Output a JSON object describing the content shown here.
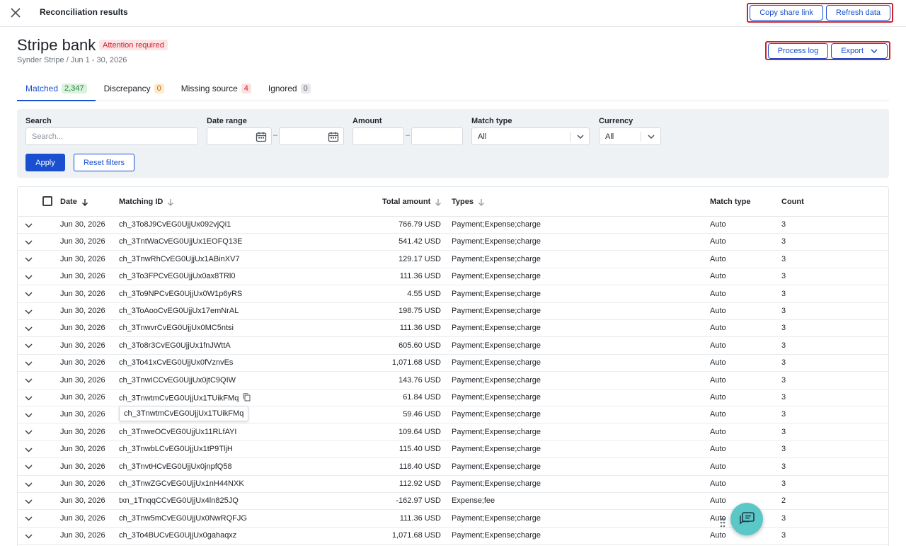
{
  "topbar": {
    "title": "Reconciliation results",
    "copy_share_link": "Copy share link",
    "refresh_data": "Refresh data"
  },
  "header": {
    "title": "Stripe bank",
    "status_badge": "Attention required",
    "subtitle": "Synder Stripe / Jun 1 - 30, 2026",
    "process_log": "Process log",
    "export": "Export"
  },
  "tabs": [
    {
      "label": "Matched",
      "count": "2,347"
    },
    {
      "label": "Discrepancy",
      "count": "0"
    },
    {
      "label": "Missing source",
      "count": "4"
    },
    {
      "label": "Ignored",
      "count": "0"
    }
  ],
  "filters": {
    "search_label": "Search",
    "search_placeholder": "Search...",
    "date_range_label": "Date range",
    "amount_label": "Amount",
    "match_type_label": "Match type",
    "match_type_value": "All",
    "currency_label": "Currency",
    "currency_value": "All",
    "apply": "Apply",
    "reset": "Reset filters",
    "range_separator": "–"
  },
  "table": {
    "columns": {
      "date": "Date",
      "matching_id": "Matching ID",
      "total_amount": "Total amount",
      "types": "Types",
      "match_type": "Match type",
      "count": "Count"
    },
    "rows": [
      {
        "date": "Jun 30, 2026",
        "id": "ch_3To8J9CvEG0UjjUx092vjQi1",
        "amount": "766.79 USD",
        "types": "Payment;Expense;charge",
        "match": "Auto",
        "count": "3"
      },
      {
        "date": "Jun 30, 2026",
        "id": "ch_3TntWaCvEG0UjjUx1EOFQ13E",
        "amount": "541.42 USD",
        "types": "Payment;Expense;charge",
        "match": "Auto",
        "count": "3"
      },
      {
        "date": "Jun 30, 2026",
        "id": "ch_3TnwRhCvEG0UjjUx1ABinXV7",
        "amount": "129.17 USD",
        "types": "Payment;Expense;charge",
        "match": "Auto",
        "count": "3"
      },
      {
        "date": "Jun 30, 2026",
        "id": "ch_3To3FPCvEG0UjjUx0ax8TRl0",
        "amount": "111.36 USD",
        "types": "Payment;Expense;charge",
        "match": "Auto",
        "count": "3"
      },
      {
        "date": "Jun 30, 2026",
        "id": "ch_3To9NPCvEG0UjjUx0W1p6yRS",
        "amount": "4.55 USD",
        "types": "Payment;Expense;charge",
        "match": "Auto",
        "count": "3"
      },
      {
        "date": "Jun 30, 2026",
        "id": "ch_3ToAooCvEG0UjjUx17emNrAL",
        "amount": "198.75 USD",
        "types": "Payment;Expense;charge",
        "match": "Auto",
        "count": "3"
      },
      {
        "date": "Jun 30, 2026",
        "id": "ch_3TnwvrCvEG0UjjUx0MC5ntsi",
        "amount": "111.36 USD",
        "types": "Payment;Expense;charge",
        "match": "Auto",
        "count": "3"
      },
      {
        "date": "Jun 30, 2026",
        "id": "ch_3To8r3CvEG0UjjUx1fnJWttA",
        "amount": "605.60 USD",
        "types": "Payment;Expense;charge",
        "match": "Auto",
        "count": "3"
      },
      {
        "date": "Jun 30, 2026",
        "id": "ch_3To41xCvEG0UjjUx0fVznvEs",
        "amount": "1,071.68 USD",
        "types": "Payment;Expense;charge",
        "match": "Auto",
        "count": "3"
      },
      {
        "date": "Jun 30, 2026",
        "id": "ch_3TnwICCvEG0UjjUx0jtC9QIW",
        "amount": "143.76 USD",
        "types": "Payment;Expense;charge",
        "match": "Auto",
        "count": "3"
      },
      {
        "date": "Jun 30, 2026",
        "id": "ch_3TnwtmCvEG0UjjUx1TUikFMq",
        "amount": "61.84 USD",
        "types": "Payment;Expense;charge",
        "match": "Auto",
        "count": "3"
      },
      {
        "date": "Jun 30, 2026",
        "id": "",
        "amount": "59.46 USD",
        "types": "Payment;Expense;charge",
        "match": "Auto",
        "count": "3"
      },
      {
        "date": "Jun 30, 2026",
        "id": "ch_3TnweOCvEG0UjjUx11RLfAYI",
        "amount": "109.64 USD",
        "types": "Payment;Expense;charge",
        "match": "Auto",
        "count": "3"
      },
      {
        "date": "Jun 30, 2026",
        "id": "ch_3TnwbLCvEG0UjjUx1tP9TljH",
        "amount": "115.40 USD",
        "types": "Payment;Expense;charge",
        "match": "Auto",
        "count": "3"
      },
      {
        "date": "Jun 30, 2026",
        "id": "ch_3TnvtHCvEG0UjjUx0jnpfQ58",
        "amount": "118.40 USD",
        "types": "Payment;Expense;charge",
        "match": "Auto",
        "count": "3"
      },
      {
        "date": "Jun 30, 2026",
        "id": "ch_3TnwZGCvEG0UjjUx1nH44NXK",
        "amount": "112.92 USD",
        "types": "Payment;Expense;charge",
        "match": "Auto",
        "count": "3"
      },
      {
        "date": "Jun 30, 2026",
        "id": "txn_1TnqqCCvEG0UjjUx4ln825JQ",
        "amount": "-162.97 USD",
        "types": "Expense;fee",
        "match": "Auto",
        "count": "2"
      },
      {
        "date": "Jun 30, 2026",
        "id": "ch_3Tnw5mCvEG0UjjUx0NwRQFJG",
        "amount": "111.36 USD",
        "types": "Payment;Expense;charge",
        "match": "Auto",
        "count": "3"
      },
      {
        "date": "Jun 30, 2026",
        "id": "ch_3To4BUCvEG0UjjUx0gahaqxz",
        "amount": "1,071.68 USD",
        "types": "Payment;Expense;charge",
        "match": "Auto",
        "count": "3"
      }
    ]
  },
  "tooltip": {
    "text": "ch_3TnwtmCvEG0UjjUx1TUikFMq"
  },
  "colors": {
    "primary": "#1a4fd0",
    "highlight_border": "#d21f2a",
    "chat_fab": "#5bc8c7"
  },
  "icons": [
    "close-icon",
    "calendar-icon",
    "chevron-down-icon",
    "sort-arrow-icon",
    "copy-icon",
    "chat-icon",
    "drag-handle-icon"
  ]
}
